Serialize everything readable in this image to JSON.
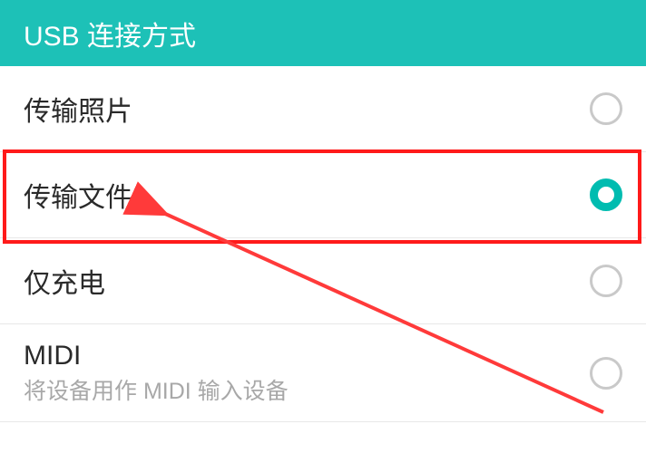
{
  "header": {
    "title": "USB 连接方式"
  },
  "options": [
    {
      "label": "传输照片",
      "sublabel": null,
      "selected": false
    },
    {
      "label": "传输文件",
      "sublabel": null,
      "selected": true
    },
    {
      "label": "仅充电",
      "sublabel": null,
      "selected": false
    },
    {
      "label": "MIDI",
      "sublabel": "将设备用作 MIDI 输入设备",
      "selected": false
    }
  ],
  "colors": {
    "accent": "#00bcb0",
    "headerBg": "#1dc1b7",
    "highlight": "#ff1a1a"
  }
}
